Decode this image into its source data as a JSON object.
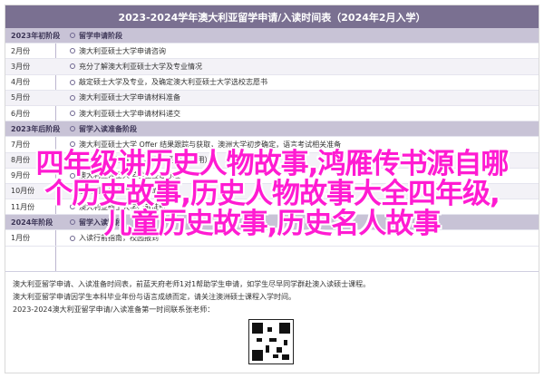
{
  "document": {
    "title": "2023-2024学年澳大利亚留学申请/入读时间表（2024年2月入学）",
    "rows": [
      {
        "type": "section",
        "period": "2023年初阶段",
        "content": "留学申请阶段"
      },
      {
        "type": "item",
        "period": "2月份",
        "content": "澳大利亚硕士大学申请咨询"
      },
      {
        "type": "item",
        "period": "3月份",
        "content": "充分了解澳大利亚硕士大学及专业情况"
      },
      {
        "type": "item",
        "period": "4月份",
        "content": "敲定硕士大学及专业，及确定澳大利亚硕士大学选校志愿书"
      },
      {
        "type": "item",
        "period": "5月份",
        "content": "澳大利亚硕士大学申请材料准备"
      },
      {
        "type": "item",
        "period": "6月份",
        "content": "澳大利亚硕士大学申请材料递交"
      },
      {
        "type": "section",
        "period": "2023年后阶段",
        "content": "留学入读准备阶段"
      },
      {
        "type": "item",
        "period": "7月份",
        "content": "澳大利亚硕士大学 Offer 结果跟踪与获取，澳洲大学初步确定，语言考试相关准备"
      },
      {
        "type": "item",
        "period": "8月份",
        "content": "申请澳大利亚硕士大学语言班  （如适用）"
      },
      {
        "type": "item",
        "period": "9月份",
        "content": "澳大利亚硕士大学学生签证办理"
      },
      {
        "type": "item",
        "period": "10月份",
        "content": "澳大利亚硕士大学学费缴纳"
      },
      {
        "type": "item",
        "period": "11月份",
        "content": "澳大利亚硕士大学行前准备"
      },
      {
        "type": "section",
        "period": "2024年阶段",
        "content": "留学入读阶段"
      },
      {
        "type": "item",
        "period": "1月份",
        "content": "入读行前指南，校园报到"
      }
    ],
    "footer_lines": [
      "澳大利亚留学申请、入读准备时间表，前蓝天府老师1对1帮助学生申请，如学生尽早同学群赴澳入读硕士课程。",
      "澳大利亚留学申请因学生本科毕业年份与语言成绩而定，请关注澳洲硕士课程入学时间。",
      "2023-2024澳大利亚留学申请/入读准备第一时间联系张老师："
    ]
  },
  "overlay": {
    "line1": "四年级讲历史人物故事,鸿雁传书源自哪",
    "line2": "个历史故事,历史人物故事大全四年级,",
    "line3": "儿童历史故事,历史名人故事"
  }
}
